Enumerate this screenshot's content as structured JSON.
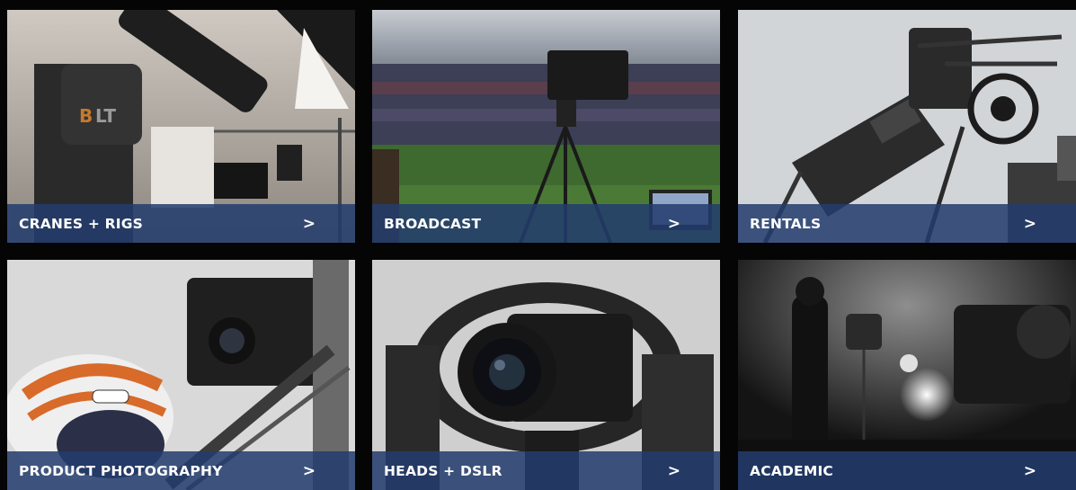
{
  "tiles": [
    {
      "label": "CRANES + RIGS",
      "arrow": ">",
      "photo": "camera-crane-robot-photo"
    },
    {
      "label": "BROADCAST",
      "arrow": ">",
      "photo": "stadium-broadcast-camera-photo"
    },
    {
      "label": "RENTALS",
      "arrow": ">",
      "photo": "rental-crane-arm-photo"
    },
    {
      "label": "PRODUCT PHOTOGRAPHY",
      "arrow": ">",
      "photo": "helmet-product-rig-photo"
    },
    {
      "label": "HEADS + DSLR",
      "arrow": ">",
      "photo": "camera-head-dslr-photo"
    },
    {
      "label": "ACADEMIC",
      "arrow": ">",
      "photo": "studio-academic-photo"
    }
  ],
  "colors": {
    "caption_bar": "#233c6e",
    "caption_text": "#ffffff",
    "gutter": "#050505"
  },
  "icons": {
    "arrow": "chevron-right-icon"
  }
}
